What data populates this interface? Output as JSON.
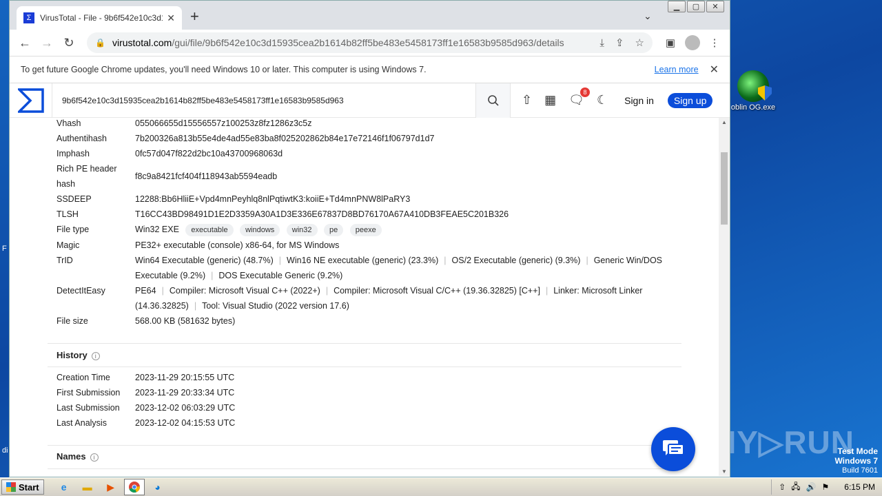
{
  "browser": {
    "tab_title": "VirusTotal - File - 9b6f542e10c3d15…",
    "url_domain": "virustotal.com",
    "url_path": "/gui/file/9b6f542e10c3d15935cea2b1614b82ff5be483e5458173ff1e16583b9585d963/details",
    "infobar_message": "To get future Google Chrome updates, you'll need Windows 10 or later. This computer is using Windows 7.",
    "infobar_link": "Learn more"
  },
  "vt": {
    "search_value": "9b6f542e10c3d15935cea2b1614b82ff5be483e5458173ff1e16583b9585d963",
    "notification_count": "8",
    "sign_in": "Sign in",
    "sign_up": "Sign up"
  },
  "properties": [
    {
      "key": "Vhash",
      "value": "055066655d15556557z100253z8fz1286z3c5z"
    },
    {
      "key": "Authentihash",
      "value": "7b200326a813b55e4de4ad55e83ba8f025202862b84e17e72146f1f06797d1d7"
    },
    {
      "key": "Imphash",
      "value": "0fc57d047f822d2bc10a43700968063d"
    },
    {
      "key": "Rich PE header hash",
      "value": "f8c9a8421fcf404f118943ab5594eadb"
    },
    {
      "key": "SSDEEP",
      "value": "12288:Bb6HliiE+Vpd4mnPeyhlq8nlPqtiwtK3:koiiE+Td4mnPNW8lPaRY3"
    },
    {
      "key": "TLSH",
      "value": "T16CC43BD98491D1E2D3359A30A1D3E336E67837D8BD76170A67A410DB3FEAE5C201B326"
    }
  ],
  "file_type": {
    "key": "File type",
    "value": "Win32 EXE",
    "tags": [
      "executable",
      "windows",
      "win32",
      "pe",
      "peexe"
    ]
  },
  "magic": {
    "key": "Magic",
    "value": "PE32+ executable (console) x86-64, for MS Windows"
  },
  "trid": {
    "key": "TrID",
    "items": [
      "Win64 Executable (generic) (48.7%)",
      "Win16 NE executable (generic) (23.3%)",
      "OS/2 Executable (generic) (9.3%)",
      "Generic Win/DOS Executable (9.2%)",
      "DOS Executable Generic (9.2%)"
    ]
  },
  "detectiteasy": {
    "key": "DetectItEasy",
    "items": [
      "PE64",
      "Compiler: Microsoft Visual C++ (2022+)",
      "Compiler: Microsoft Visual C/C++ (19.36.32825) [C++]",
      "Linker: Microsoft Linker (14.36.32825)",
      "Tool: Visual Studio (2022 version 17.6)"
    ]
  },
  "file_size": {
    "key": "File size",
    "value": "568.00 KB (581632 bytes)"
  },
  "history": {
    "title": "History",
    "rows": [
      {
        "key": "Creation Time",
        "value": "2023-11-29 20:15:55 UTC"
      },
      {
        "key": "First Submission",
        "value": "2023-11-29 20:33:34 UTC"
      },
      {
        "key": "Last Submission",
        "value": "2023-12-02 06:03:29 UTC"
      },
      {
        "key": "Last Analysis",
        "value": "2023-12-02 04:15:53 UTC"
      }
    ]
  },
  "names": {
    "title": "Names"
  },
  "desktop": {
    "icon_label": "oblin OG.exe",
    "watermark": "ANY▷RUN",
    "test_mode": "Test Mode",
    "os_name": "Windows 7",
    "build": "Build 7601"
  },
  "taskbar": {
    "start": "Start",
    "clock": "6:15 PM"
  }
}
